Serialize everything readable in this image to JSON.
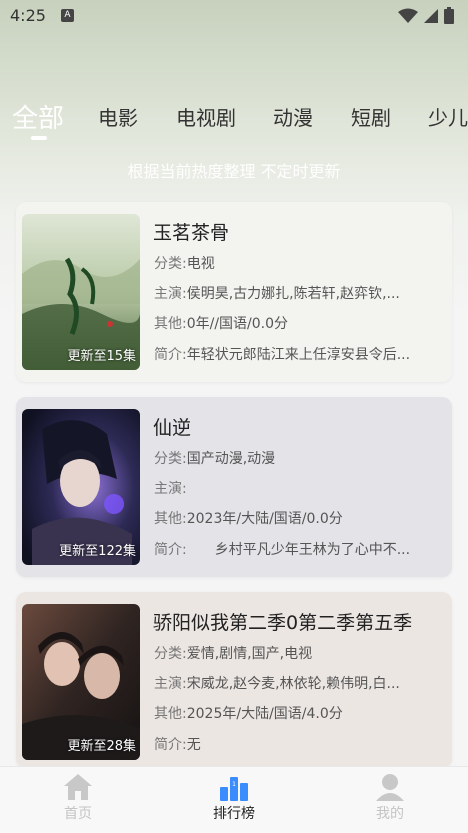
{
  "status_bar": {
    "time": "4:25",
    "notif_letter": "A"
  },
  "tabs": [
    {
      "label": "全部",
      "active": true
    },
    {
      "label": "电影",
      "active": false
    },
    {
      "label": "电视剧",
      "active": false
    },
    {
      "label": "动漫",
      "active": false
    },
    {
      "label": "短剧",
      "active": false
    },
    {
      "label": "少儿",
      "active": false
    }
  ],
  "subtitle": "根据当前热度整理 不定时更新",
  "labels": {
    "category": "分类:",
    "cast": "主演:",
    "other": "其他:",
    "intro": "简介:"
  },
  "items": [
    {
      "title": "玉茗茶骨",
      "badge": "更新至15集",
      "category": "电视",
      "cast": "侯明昊,古力娜扎,陈若轩,赵弈钦,...",
      "other": "0年//国语/0.0分",
      "intro": "年轻状元郎陆江来上任淳安县令后..."
    },
    {
      "title": "仙逆",
      "badge": "更新至122集",
      "category": "国产动漫,动漫",
      "cast": "",
      "other": "2023年/大陆/国语/0.0分",
      "intro": "　　乡村平凡少年王林为了心中不..."
    },
    {
      "title": "骄阳似我第二季0第二季第五季",
      "badge": "更新至28集",
      "category": "爱情,剧情,国产,电视",
      "cast": "宋威龙,赵今麦,林依轮,赖伟明,白...",
      "other": "2025年/大陆/国语/4.0分",
      "intro": "无"
    }
  ],
  "bottom_nav": [
    {
      "label": "首页",
      "icon": "home-icon",
      "active": false
    },
    {
      "label": "排行榜",
      "icon": "ranking-icon",
      "active": true
    },
    {
      "label": "我的",
      "icon": "user-icon",
      "active": false
    }
  ],
  "colors": {
    "active_tab": "#ffffff",
    "inactive_tab": "#333333",
    "nav_active": "#222222",
    "nav_inactive": "#c4c4c4",
    "ranking_blue": "#3b8cff"
  }
}
